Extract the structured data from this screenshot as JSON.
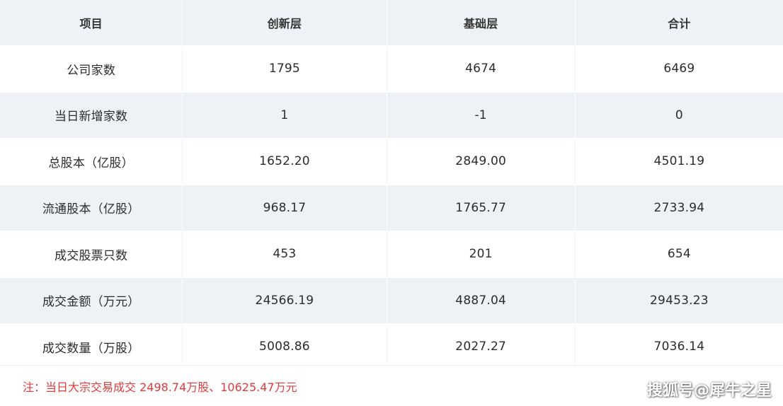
{
  "table": {
    "headers": [
      "项目",
      "创新层",
      "基础层",
      "合计"
    ],
    "rows": [
      [
        "公司家数",
        "1795",
        "4674",
        "6469"
      ],
      [
        "当日新增家数",
        "1",
        "-1",
        "0"
      ],
      [
        "总股本（亿股）",
        "1652.20",
        "2849.00",
        "4501.19"
      ],
      [
        "流通股本（亿股）",
        "968.17",
        "1765.77",
        "2733.94"
      ],
      [
        "成交股票只数",
        "453",
        "201",
        "654"
      ],
      [
        "成交金额（万元）",
        "24566.19",
        "4887.04",
        "29453.23"
      ],
      [
        "成交数量（万股）",
        "5008.86",
        "2027.27",
        "7036.14"
      ]
    ]
  },
  "note": "注：当日大宗交易成交 2498.74万股、10625.47万元",
  "watermark": "搜狐号@犀牛之星",
  "colors": {
    "header_bg": "#eef2f7",
    "note_text": "#e03b3b"
  }
}
